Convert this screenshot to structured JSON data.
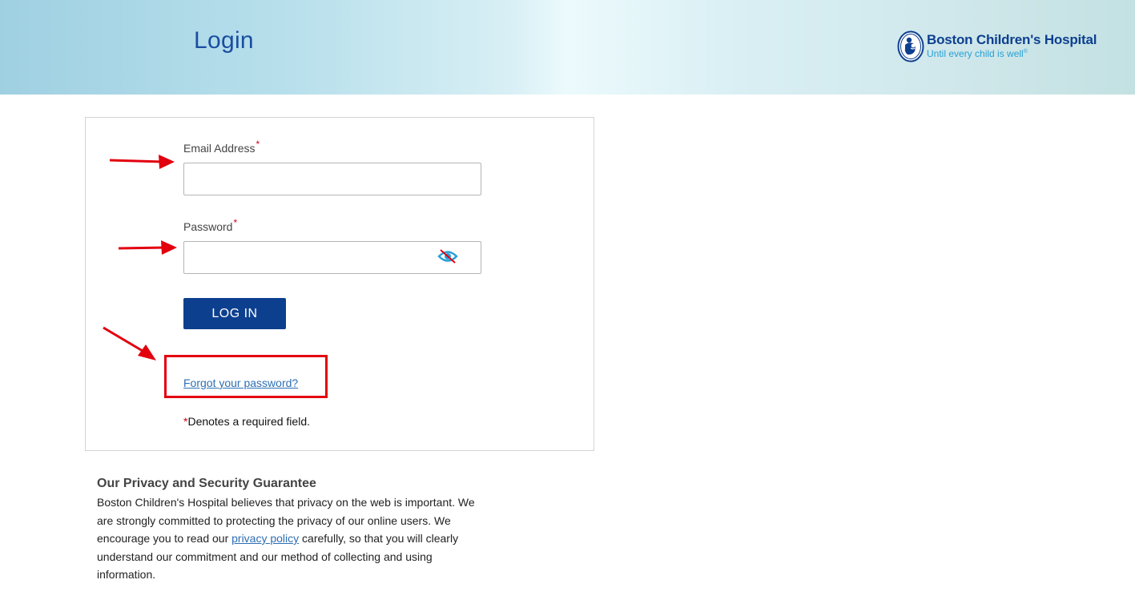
{
  "header": {
    "title": "Login",
    "brand": {
      "name": "Boston Children's Hospital",
      "tagline": "Until every child is well",
      "tagline_mark": "®"
    }
  },
  "form": {
    "email_label": "Email Address",
    "email_value": "",
    "password_label": "Password",
    "password_value": "",
    "required_marker": "*",
    "login_button": "LOG IN",
    "forgot_link": "Forgot your password?",
    "required_note": "Denotes a required field."
  },
  "icons": {
    "password_toggle": "eye-slash-icon",
    "brand_logo": "boston-childrens-hospital-logo-icon"
  },
  "privacy": {
    "heading": "Our Privacy and Security Guarantee",
    "text_before_link": "Boston Children's Hospital believes that privacy on the web is important. We are strongly committed to protecting the privacy of our online users. We encourage you to read our ",
    "link_text": "privacy policy",
    "text_after_link": " carefully, so that you will clearly understand our commitment and our method of collecting and using information."
  },
  "colors": {
    "brand_blue": "#0d3f8f",
    "link_blue": "#2d6fb4",
    "tagline_blue": "#27a0d6",
    "annotation_red": "#e3000f",
    "required_red": "#d0021b"
  }
}
